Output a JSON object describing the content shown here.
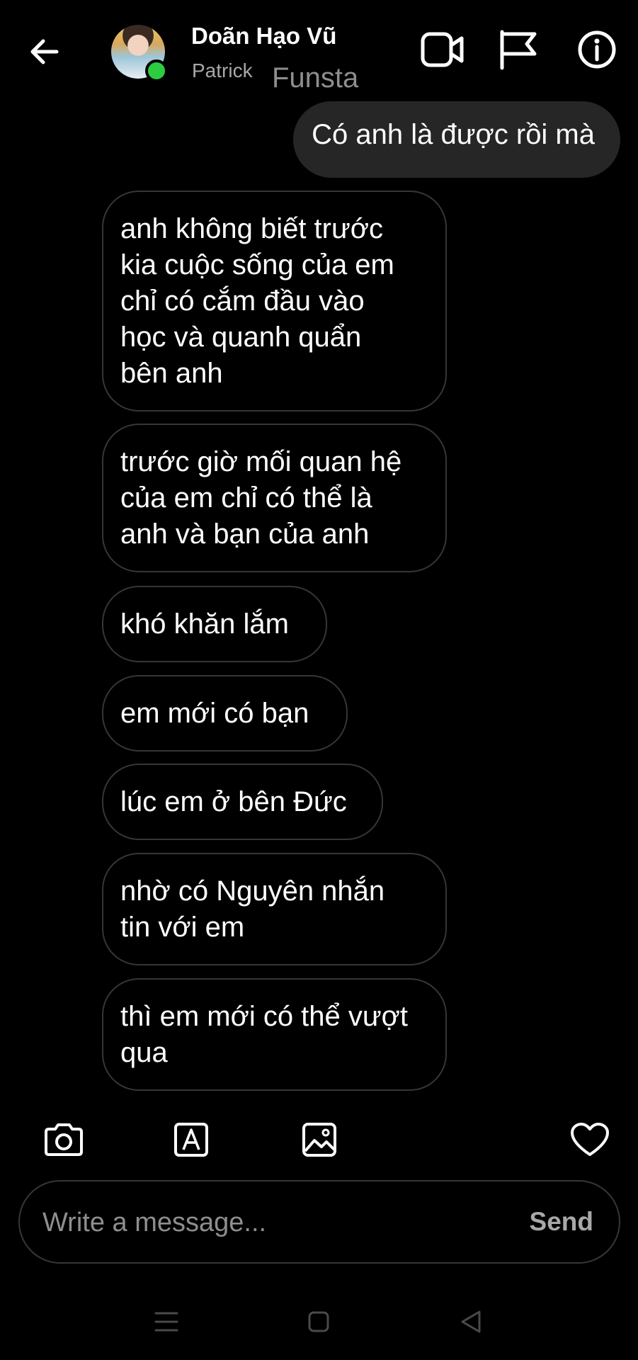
{
  "header": {
    "contact_name": "Doãn Hạo Vũ",
    "contact_username": "Patrick",
    "app_tag": "Funsta",
    "online_color": "#2ecc40",
    "icons": [
      "back-arrow-icon",
      "video-camera-icon",
      "flag-icon",
      "info-icon"
    ]
  },
  "messages": [
    {
      "direction": "sent",
      "text": "Có anh là được rồi mà"
    },
    {
      "direction": "received",
      "lines": [
        "anh không biết trước",
        "kia cuộc sống của em",
        "chỉ có cắm đầu vào",
        "học và quanh quẩn",
        "bên anh"
      ]
    },
    {
      "direction": "received",
      "lines": [
        "trước giờ mối quan hệ",
        "của em chỉ có thể là",
        "anh và bạn của anh"
      ]
    },
    {
      "direction": "received",
      "lines": [
        "khó khăn lắm"
      ]
    },
    {
      "direction": "received",
      "lines": [
        "em mới có bạn"
      ]
    },
    {
      "direction": "received",
      "lines": [
        "lúc em ở bên Đức"
      ]
    },
    {
      "direction": "received",
      "lines": [
        "nhờ có Nguyên nhắn",
        "tin với em"
      ]
    },
    {
      "direction": "received",
      "lines": [
        "thì em mới có thể vượt",
        "qua"
      ]
    }
  ],
  "toolbar": {
    "icons": [
      "camera-icon",
      "text-style-icon",
      "gallery-icon",
      "heart-icon"
    ]
  },
  "composer": {
    "placeholder": "Write a message...",
    "value": "",
    "send_label": "Send"
  },
  "system_nav": {
    "icons": [
      "menu-icon",
      "home-icon",
      "back-triangle-icon"
    ]
  },
  "colors": {
    "background": "#000000",
    "sent_bubble": "#262626",
    "received_border": "#363636",
    "muted_text": "#8e8e8e"
  }
}
